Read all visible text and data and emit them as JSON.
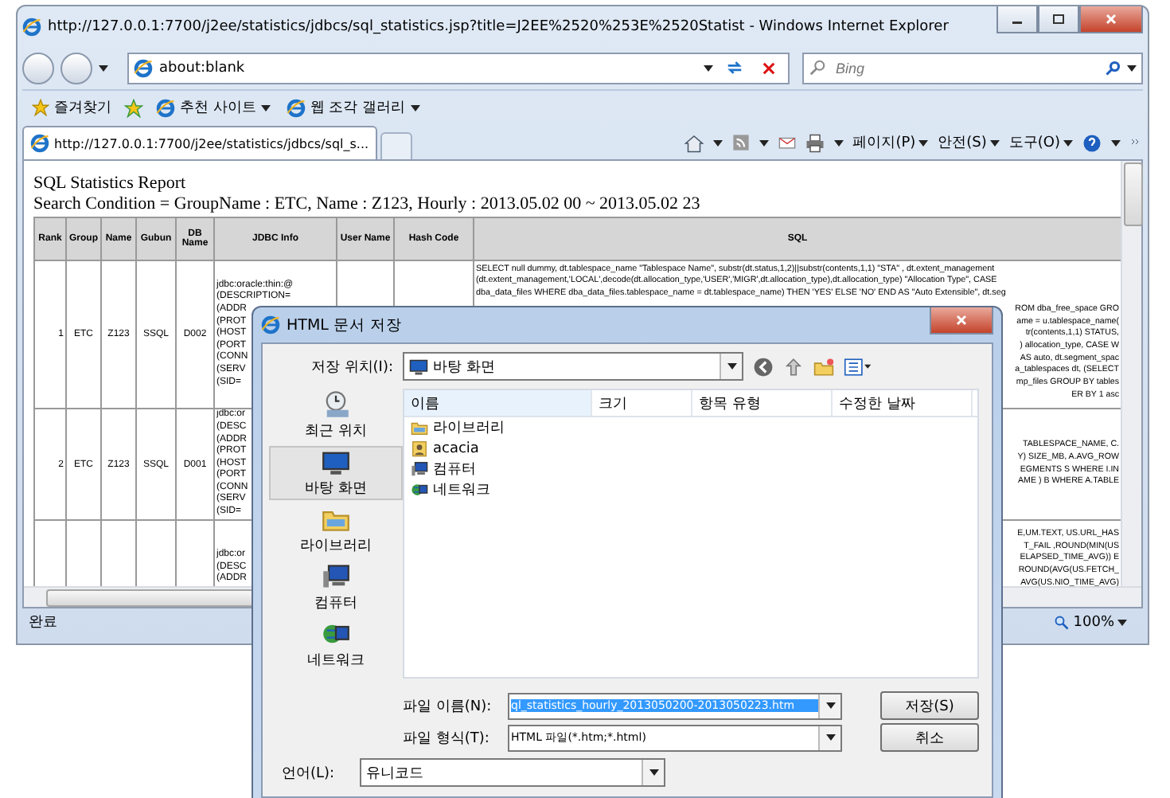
{
  "browser": {
    "title": "http://127.0.0.1:7700/j2ee/statistics/jdbcs/sql_statistics.jsp?title=J2EE%2520%253E%2520Statist - Windows Internet Explorer",
    "address": "about:blank",
    "search": {
      "placeholder": "Bing"
    },
    "favorites_bar": {
      "favorites": "즐겨찾기",
      "links": [
        "추천 사이트",
        "웹 조각 갤러리"
      ]
    },
    "tabs": [
      {
        "label": "http://127.0.0.1:7700/j2ee/statistics/jdbcs/sql_s...",
        "selected": true
      }
    ],
    "command_bar": [
      "페이지(P)",
      "안전(S)",
      "도구(O)"
    ],
    "report": {
      "title": "SQL Statistics Report",
      "condition": "Search Condition = GroupName : ETC, Name : Z123, Hourly : 2013.05.02 00 ~ 2013.05.02 23"
    },
    "table": {
      "columns": [
        "Rank",
        "Group",
        "Name",
        "Gubun",
        "DB Name",
        "JDBC Info",
        "User Name",
        "Hash Code",
        "SQL"
      ],
      "rows": [
        {
          "rank": "1",
          "group": "ETC",
          "name": "Z123",
          "gubun": "SSQL",
          "db_name": "D002",
          "jdbc_info": [
            "jdbc:oracle:thin:@",
            "(DESCRIPTION=",
            "(ADDR",
            "(PROT",
            "(HOST",
            "(PORT",
            "(CONN",
            "(SERV",
            "(SID="
          ],
          "sql": [
            "SELECT null dummy, dt.tablespace_name \"Tablespace Name\", substr(dt.status,1,2)||substr(contents,1,1) \"STA\" , dt.extent_management",
            "(dt.extent_management,'LOCAL',decode(dt.allocation_type,'USER','MIGR',dt.allocation_type),dt.allocation_type) \"Allocation Type\", CASE",
            "dba_data_files WHERE dba_data_files.tablespace_name = dt.tablespace_name) THEN 'YES' ELSE 'NO' END AS \"Auto Extensible\", dt.seg"
          ],
          "sql_fragments": [
            "ROM dba_free_space GRO",
            "ame = u.tablespace_name(",
            "tr(contents,1,1) STATUS,",
            ") allocation_type, CASE W",
            "AS auto, dt.segment_spac",
            "a_tablespaces dt, (SELECT",
            "mp_files GROUP BY tables",
            "ER BY 1 asc"
          ]
        },
        {
          "rank": "2",
          "group": "ETC",
          "name": "Z123",
          "gubun": "SSQL",
          "db_name": "D001",
          "jdbc_info": [
            "jdbc:or",
            "(DESC",
            "(ADDR",
            "(PROT",
            "(HOST",
            "(PORT",
            "(CONN",
            "(SERV",
            "(SID="
          ],
          "sql_fragments": [
            "TABLESPACE_NAME, C.",
            "Y) SIZE_MB, A.AVG_ROW",
            "EGMENTS S WHERE I.IN",
            "AME ) B WHERE A.TABLE"
          ]
        },
        {
          "jdbc_info": [
            "jdbc:or",
            "(DESC",
            "(ADDR"
          ],
          "sql_fragments": [
            "E,UM.TEXT, US.URL_HAS",
            "T_FAIL ,ROUND(MIN(US",
            "ELAPSED_TIME_AVG)) E",
            "ROUND(AVG(US.FETCH_",
            "AVG(US.NIO_TIME_AVG)"
          ]
        }
      ]
    },
    "status_bar": {
      "status": "완료",
      "zoom": "100%"
    }
  },
  "dialog": {
    "title": "HTML 문서 저장",
    "save_in": {
      "label": "저장 위치(I):",
      "value": "바탕 화면"
    },
    "places": [
      {
        "label": "최근 위치",
        "kind": "recent",
        "selected": false
      },
      {
        "label": "바탕 화면",
        "kind": "desktop",
        "selected": true
      },
      {
        "label": "라이브러리",
        "kind": "library",
        "selected": false
      },
      {
        "label": "컴퓨터",
        "kind": "computer",
        "selected": false
      },
      {
        "label": "네트워크",
        "kind": "network",
        "selected": false
      }
    ],
    "file_list": {
      "columns": [
        "이름",
        "크기",
        "항목 유형",
        "수정한 날짜"
      ],
      "items": [
        {
          "name": "라이브러리",
          "kind": "library"
        },
        {
          "name": "acacia",
          "kind": "user"
        },
        {
          "name": "컴퓨터",
          "kind": "computer"
        },
        {
          "name": "네트워크",
          "kind": "network"
        }
      ]
    },
    "file_name": {
      "label": "파일 이름(N):",
      "value": "ql_statistics_hourly_2013050200-2013050223.htm",
      "text_selected": true
    },
    "file_type": {
      "label": "파일 형식(T):",
      "value": "HTML 파일(*.htm;*.html)"
    },
    "language": {
      "label": "언어(L):",
      "value": "유니코드"
    },
    "buttons": [
      "저장(S)",
      "취소"
    ]
  }
}
